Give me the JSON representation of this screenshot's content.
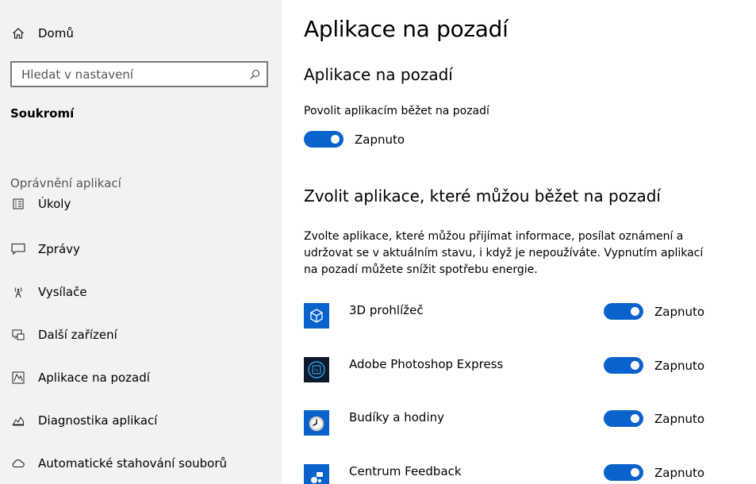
{
  "sidebar": {
    "home_label": "Domů",
    "search_placeholder": "Hledat v nastavení",
    "section_title": "Soukromí",
    "group_label": "Oprávnění aplikací",
    "items": [
      {
        "label": "Úkoly",
        "icon": "tasks-icon"
      },
      {
        "label": "Zprávy",
        "icon": "message-icon"
      },
      {
        "label": "Vysílače",
        "icon": "antenna-icon"
      },
      {
        "label": "Další zařízení",
        "icon": "devices-icon"
      },
      {
        "label": "Aplikace na pozadí",
        "icon": "background-apps-icon"
      },
      {
        "label": "Diagnostika aplikací",
        "icon": "diagnostics-icon"
      },
      {
        "label": "Automatické stahování souborů",
        "icon": "cloud-icon"
      }
    ]
  },
  "main": {
    "page_title": "Aplikace na pozadí",
    "section1_title": "Aplikace na pozadí",
    "allow_label": "Povolit aplikacím běžet na pozadí",
    "allow_state": "Zapnuto",
    "section2_title": "Zvolit aplikace, které můžou běžet na pozadí",
    "description": "Zvolte aplikace, které můžou přijímat informace, posílat oznámení a udržovat se v aktuálním stavu, i když je nepoužíváte. Vypnutím aplikací na pozadí můžete snížit spotřebu energie.",
    "apps": [
      {
        "name": "3D prohlížeč",
        "state": "Zapnuto",
        "on": true
      },
      {
        "name": "Adobe Photoshop Express",
        "state": "Zapnuto",
        "on": true
      },
      {
        "name": "Budíky a hodiny",
        "state": "Zapnuto",
        "on": true
      },
      {
        "name": "Centrum Feedback",
        "state": "Zapnuto",
        "on": true
      }
    ]
  },
  "colors": {
    "accent": "#0a63cc",
    "sidebar_bg": "#f2f2f2"
  }
}
